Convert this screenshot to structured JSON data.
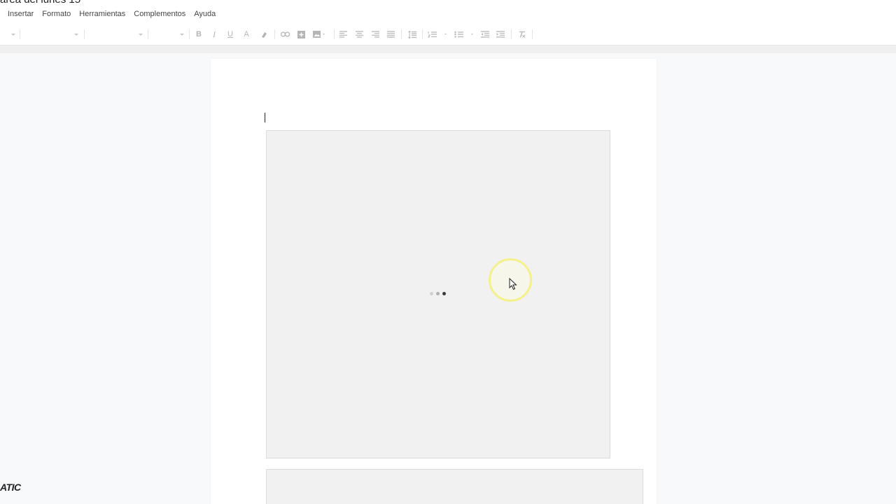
{
  "document": {
    "title": "area del lunes 15"
  },
  "menu": {
    "items": [
      "Insertar",
      "Formato",
      "Herramientas",
      "Complementos",
      "Ayuda"
    ]
  },
  "toolbar": {
    "bold_label": "B",
    "italic_label": "I",
    "underline_label": "U",
    "text_color_label": "A",
    "icons": [
      "highlighter-icon",
      "link-icon",
      "insert-comment-icon",
      "insert-image-icon",
      "align-left-icon",
      "align-center-icon",
      "align-right-icon",
      "align-justify-icon",
      "line-spacing-icon",
      "numbered-list-icon",
      "bulleted-list-icon",
      "decrease-indent-icon",
      "increase-indent-icon",
      "clear-formatting-icon"
    ]
  },
  "content": {
    "image_state": "loading"
  },
  "colors": {
    "toolbar_icon": "#b5b5b5",
    "placeholder_bg": "#f1f1f1",
    "highlight_ring": "#f4f08a",
    "loader_dot_light": "#d0d0d0",
    "loader_dot_mid": "#b0b0b0",
    "loader_dot_dark": "#3c3c3c"
  },
  "overlay": {
    "watermark_text": "ATIC"
  }
}
